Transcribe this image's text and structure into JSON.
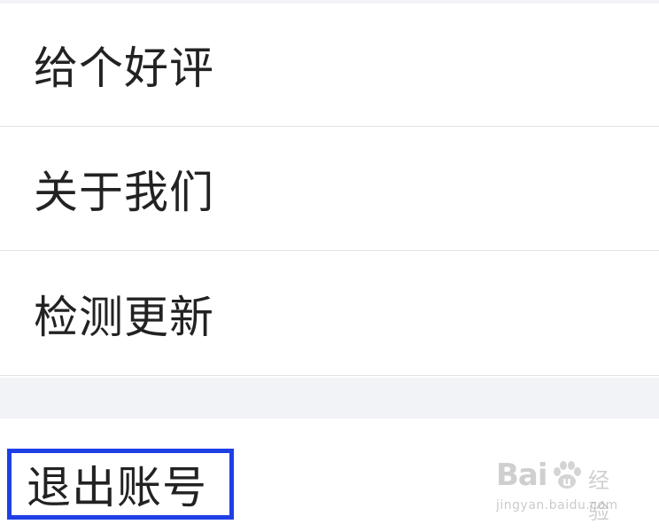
{
  "menu": {
    "items": [
      {
        "label": "给个好评"
      },
      {
        "label": "关于我们"
      },
      {
        "label": "检测更新"
      }
    ],
    "logout": {
      "label": "退出账号"
    }
  },
  "highlight": {
    "color": "#1f3fe6"
  },
  "watermark": {
    "brand_left": "Bai",
    "brand_right": "u",
    "brand_cn": "经验",
    "url": "jingyan.baidu.com"
  }
}
